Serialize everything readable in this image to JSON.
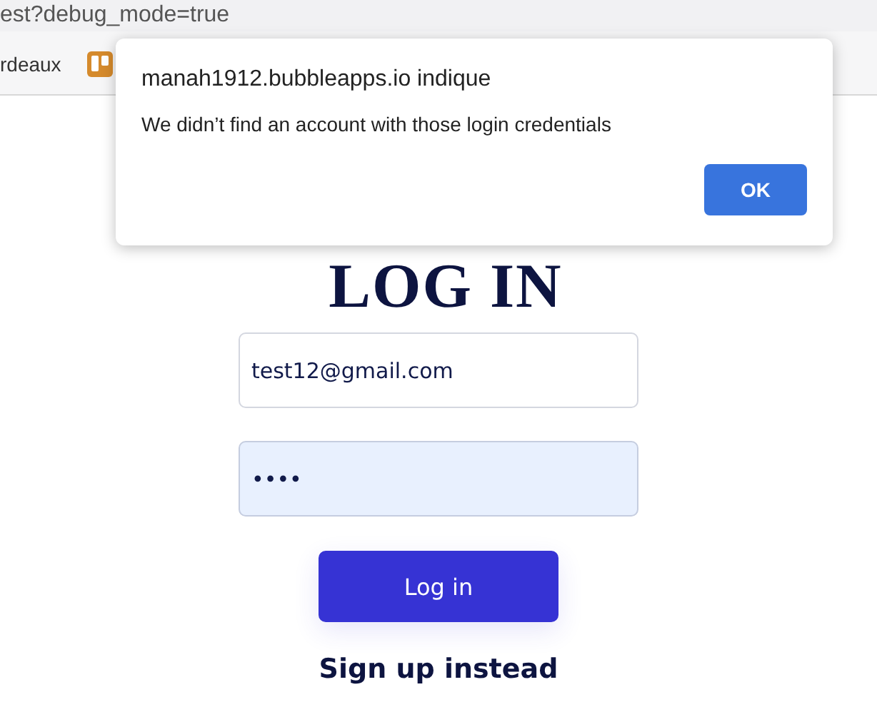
{
  "address_bar": {
    "url": "est?debug_mode=true"
  },
  "bookmarks_bar": {
    "items": [
      "rdeaux"
    ]
  },
  "page": {
    "heading": "LOG IN",
    "email_field": {
      "value": "test12@gmail.com"
    },
    "password_field": {
      "value": "••••",
      "autofilled": true
    },
    "login_button": "Log in",
    "signup_link": "Sign up instead"
  },
  "alert_dialog": {
    "title": "manah1912.bubbleapps.io indique",
    "message": "We didn’t find an account with those login credentials",
    "button": "OK"
  }
}
